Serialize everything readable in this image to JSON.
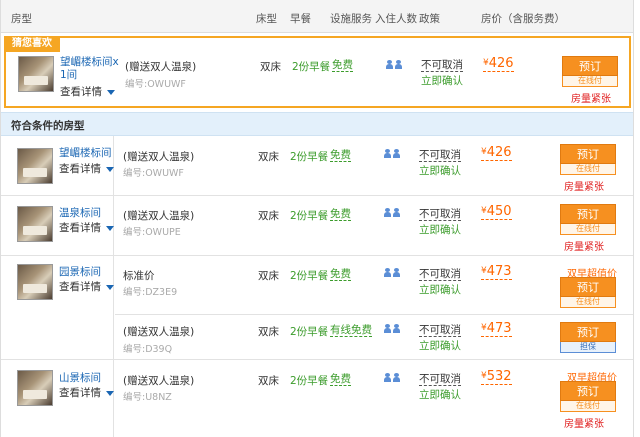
{
  "header": {
    "room_type": "房型",
    "bed": "床型",
    "breakfast": "早餐",
    "facilities": "设施服务",
    "occupancy": "入住人数",
    "policy": "政策",
    "price": "房价（含服务费）"
  },
  "featured": {
    "tag": "猜您喜欢",
    "room_name_line1": "望嵋楼标间x",
    "room_name_line2": "1间",
    "detail": "查看详情",
    "package": "(赠送双人温泉)",
    "code": "编号:OWUWF",
    "bed": "双床",
    "breakfast": "2份早餐",
    "facility": "免费",
    "policy": "不可取消",
    "confirm": "立即确认",
    "currency": "¥",
    "price": "426",
    "book": "预订",
    "pay": "在线付",
    "status": "房量紧张"
  },
  "section_title": "符合条件的房型",
  "rows": [
    {
      "room_name": "望嵋楼标间",
      "detail": "查看详情",
      "package": "(赠送双人温泉)",
      "code": "编号:OWUWF",
      "bed": "双床",
      "breakfast": "2份早餐",
      "facility": "免费",
      "policy": "不可取消",
      "confirm": "立即确认",
      "currency": "¥",
      "price": "426",
      "book": "预订",
      "pay": "在线付",
      "status": "房量紧张"
    },
    {
      "room_name": "温泉标间",
      "detail": "查看详情",
      "package": "(赠送双人温泉)",
      "code": "编号:OWUPE",
      "bed": "双床",
      "breakfast": "2份早餐",
      "facility": "免费",
      "policy": "不可取消",
      "confirm": "立即确认",
      "currency": "¥",
      "price": "450",
      "book": "预订",
      "pay": "在线付",
      "status": "房量紧张"
    },
    {
      "room_name": "园景标间",
      "detail": "查看详情",
      "package": "标准价",
      "code": "编号:DZ3E9",
      "bed": "双床",
      "breakfast": "2份早餐",
      "facility": "免费",
      "policy": "不可取消",
      "confirm": "立即确认",
      "currency": "¥",
      "price": "473",
      "deal": "双早超值价",
      "book": "预订",
      "pay": "在线付"
    },
    {
      "package": "(赠送双人温泉)",
      "code": "编号:D39Q",
      "bed": "双床",
      "breakfast": "2份早餐",
      "facility": "有线免费",
      "policy": "不可取消",
      "confirm": "立即确认",
      "currency": "¥",
      "price": "473",
      "book": "预订",
      "guarantee": "担保"
    },
    {
      "room_name": "山景标间",
      "detail": "查看详情",
      "package": "(赠送双人温泉)",
      "code": "编号:U8NZ",
      "bed": "双床",
      "breakfast": "2份早餐",
      "facility": "免费",
      "policy": "不可取消",
      "confirm": "立即确认",
      "currency": "¥",
      "price": "532",
      "deal": "双早超值价",
      "book": "预订",
      "pay": "在线付",
      "status": "房量紧张"
    }
  ],
  "colors": {
    "accent_orange": "#f69020",
    "price_orange": "#ff6600",
    "link_blue": "#1a66b3",
    "green": "#3c9c2c",
    "alert_red": "#e02020",
    "section_bg": "#e3f0fb"
  }
}
